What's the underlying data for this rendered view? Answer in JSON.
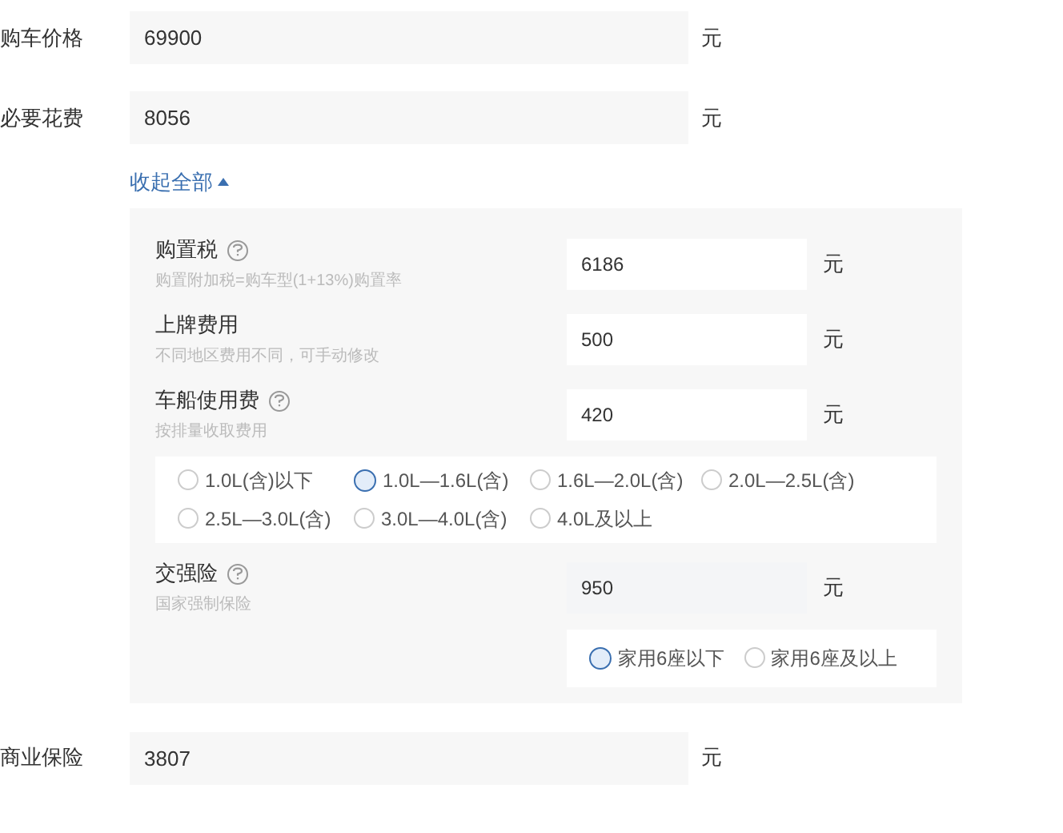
{
  "price": {
    "label": "购车价格",
    "value": "69900",
    "unit": "元"
  },
  "required": {
    "label": "必要花费",
    "value": "8056",
    "unit": "元"
  },
  "toggle": {
    "label": "收起全部",
    "expanded": true
  },
  "items": [
    {
      "label": "购置税",
      "help": true,
      "hint": "购置附加税=购车型(1+13%)购置率",
      "value": "6186",
      "unit": "元"
    },
    {
      "label": "上牌费用",
      "help": false,
      "hint": "不同地区费用不同，可手动修改",
      "value": "500",
      "unit": "元"
    },
    {
      "label": "车船使用费",
      "help": true,
      "hint": "按排量收取费用",
      "value": "420",
      "unit": "元",
      "options": [
        {
          "label": "1.0L(含)以下",
          "selected": false
        },
        {
          "label": "1.0L—1.6L(含)",
          "selected": true
        },
        {
          "label": "1.6L—2.0L(含)",
          "selected": false
        },
        {
          "label": "2.0L—2.5L(含)",
          "selected": false
        },
        {
          "label": "2.5L—3.0L(含)",
          "selected": false
        },
        {
          "label": "3.0L—4.0L(含)",
          "selected": false
        },
        {
          "label": "4.0L及以上",
          "selected": false
        }
      ]
    },
    {
      "label": "交强险",
      "help": true,
      "hint": "国家强制保险",
      "value": "950",
      "unit": "元",
      "options": [
        {
          "label": "家用6座以下",
          "selected": true
        },
        {
          "label": "家用6座及以上",
          "selected": false
        }
      ]
    }
  ],
  "commercial": {
    "label": "商业保险",
    "value": "3807",
    "unit": "元"
  }
}
